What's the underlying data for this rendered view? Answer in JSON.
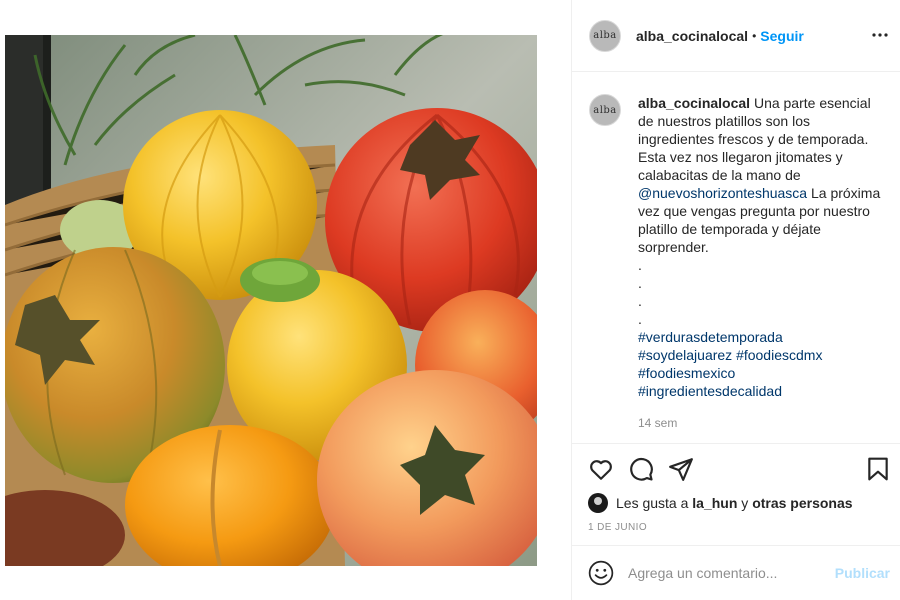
{
  "post": {
    "image_alt": "Jitomates y calabacitas en una canasta",
    "author": {
      "username": "alba_cocinalocal",
      "avatar_text": "alba"
    },
    "header": {
      "separator": "•",
      "follow_label": "Seguir",
      "more_icon": "more-horizontal-icon"
    },
    "caption": {
      "username": "alba_cocinalocal",
      "text_before_mention": "Una parte esencial de nuestros platillos son los ingredientes frescos y de temporada. Esta vez nos llegaron jitomates y calabacitas de la mano de",
      "mention": "@nuevoshorizonteshuasca",
      "text_after_mention": "La próxima vez que vengas pregunta por nuestro platillo de temporada y déjate sorprender.",
      "dots": [
        ".",
        ".",
        ".",
        "."
      ],
      "hashtags": [
        [
          "#verdurasdetemporada"
        ],
        [
          "#soydelajuarez",
          "#foodiescdmx"
        ],
        [
          "#foodiesmexico"
        ],
        [
          "#ingredientesdecalidad"
        ]
      ],
      "time": "14 sem"
    },
    "actions": {
      "like_icon": "heart-icon",
      "comment_icon": "comment-icon",
      "share_icon": "share-icon",
      "save_icon": "bookmark-icon"
    },
    "likes": {
      "prefix": "Les gusta a",
      "user": "la_hun",
      "conjunction": "y",
      "others": "otras personas"
    },
    "date": "1 DE JUNIO",
    "comment_box": {
      "emoji_icon": "emoji-icon",
      "placeholder": "Agrega un comentario...",
      "post_label": "Publicar"
    },
    "colors": {
      "link_blue": "#0095f6",
      "hashtag_blue": "#00376b",
      "muted_gray": "#8e8e8e",
      "disabled_blue": "#b2dffc"
    }
  }
}
